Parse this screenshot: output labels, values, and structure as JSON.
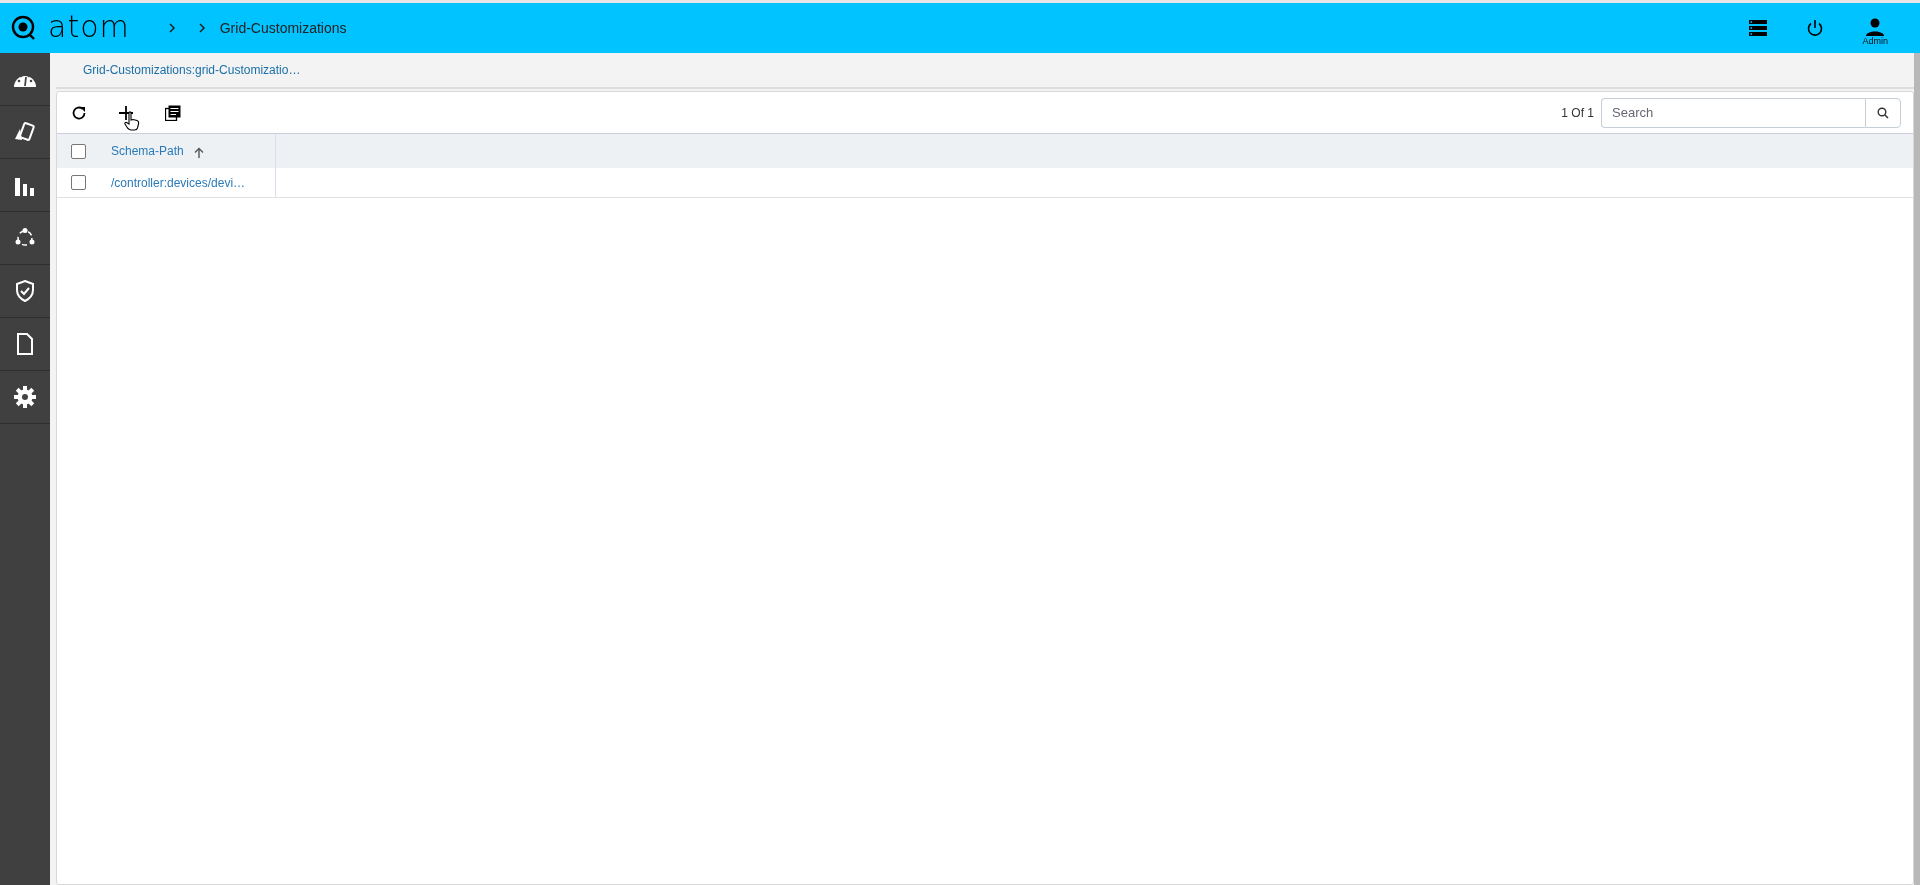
{
  "header": {
    "logo": "atom",
    "breadcrumb": [
      "Grid-Customizations"
    ],
    "user": "Admin"
  },
  "sidebar": {
    "items": [
      {
        "kind": "dashboard"
      },
      {
        "kind": "devices"
      },
      {
        "kind": "charts"
      },
      {
        "kind": "network"
      },
      {
        "kind": "security"
      },
      {
        "kind": "document"
      },
      {
        "kind": "settings"
      }
    ]
  },
  "tab": {
    "label": "Grid-Customizations:grid-Customizatio…"
  },
  "toolbar": {
    "pager": "1 Of 1",
    "search": {
      "placeholder": "Search"
    }
  },
  "table": {
    "columns": [
      {
        "label": "Schema-Path",
        "sorted_ascending": true
      }
    ],
    "rows": [
      {
        "checked": false,
        "cells": [
          "/controller:devices/devi…"
        ]
      }
    ],
    "header_checked": false
  }
}
